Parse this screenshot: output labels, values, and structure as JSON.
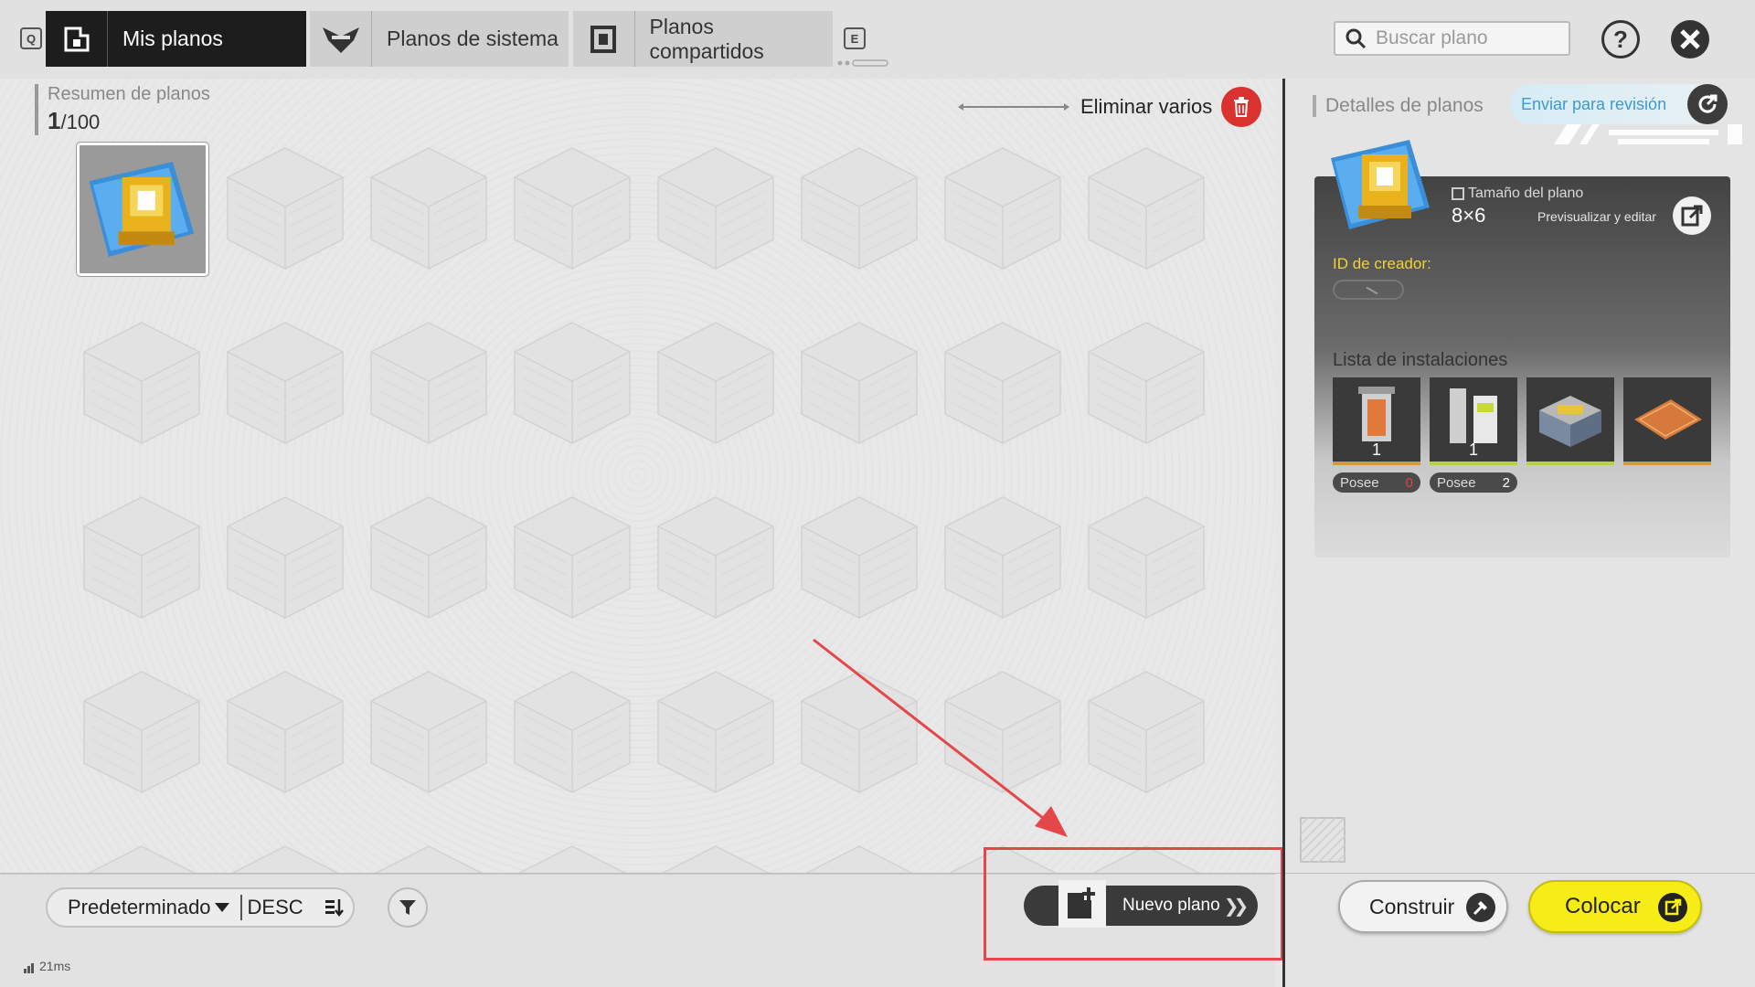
{
  "tabs": [
    {
      "label": "Mis planos",
      "active": true,
      "icon": "blueprint-icon"
    },
    {
      "label": "Planos de sistema",
      "active": false,
      "icon": "endfield-logo-icon"
    },
    {
      "label": "Planos compartidos",
      "active": false,
      "icon": "shared-blueprint-icon"
    }
  ],
  "hotkeys": {
    "prev": "Q",
    "next": "E"
  },
  "search": {
    "placeholder": "Buscar plano",
    "value": ""
  },
  "summary": {
    "title": "Resumen de planos",
    "count": "1",
    "total": "/100"
  },
  "delete_many": {
    "label": "Eliminar varios"
  },
  "grid": {
    "rows": 5,
    "cols": 8,
    "filled_slots": 1
  },
  "sort": {
    "mode": "Predeterminado",
    "order": "DESC"
  },
  "new_plan": {
    "label": "Nuevo plano"
  },
  "latency": {
    "text": "21ms"
  },
  "details": {
    "title": "Detalles de planos",
    "review_label": "Enviar para revisión",
    "size_label": "Tamaño del plano",
    "size_value": "8×6",
    "preview_label": "Previsualizar y editar",
    "creator_label": "ID de creador:",
    "facilities_label": "Lista de instalaciones",
    "facilities": [
      {
        "qty": "1",
        "owned_label": "Posee",
        "owned": "0",
        "owned_color": "#e24444"
      },
      {
        "qty": "1",
        "owned_label": "Posee",
        "owned": "2",
        "owned_color": "#ffffff"
      },
      {
        "qty": "",
        "owned_label": "",
        "owned": ""
      },
      {
        "qty": "",
        "owned_label": "",
        "owned": ""
      }
    ]
  },
  "actions": {
    "build_label": "Construir",
    "place_label": "Colocar"
  },
  "colors": {
    "accent_yellow": "#f6ec18",
    "delete_red": "#d9322f",
    "highlight_red": "#e3474a",
    "review_blue": "#3a9bd0"
  }
}
